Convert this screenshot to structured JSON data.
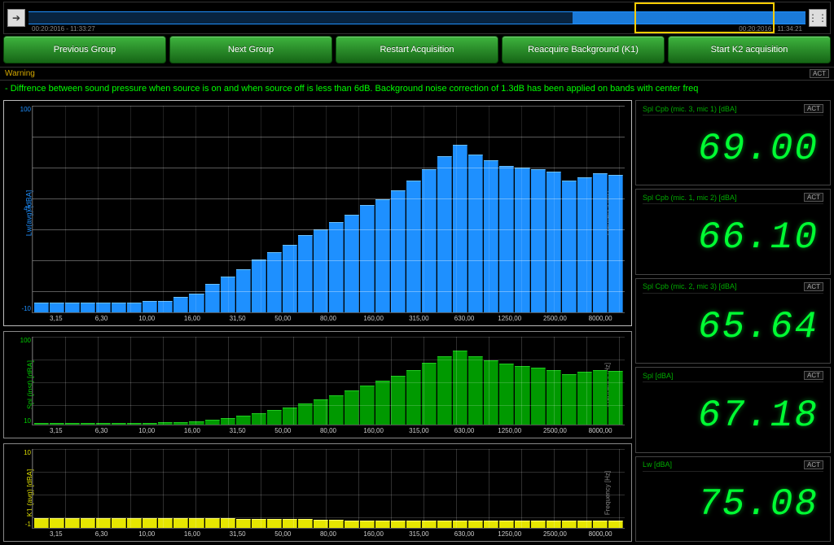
{
  "waveform": {
    "timestamp_left": "00:20:2016 - 11:33:27",
    "timestamp_right": "00:20:2016 - 11:34:21"
  },
  "buttons": {
    "prev": "Previous Group",
    "next": "Next Group",
    "restart": "Restart Acquisition",
    "reacquire": "Reacquire Background (K1)",
    "start": "Start K2 acquisition"
  },
  "warning": {
    "label": "Warning",
    "badge": "ACT",
    "text": "- Diffrence between sound pressure when source is on and when source off is less than 6dB. Background noise correction of 1.3dB has been applied on bands with center freq"
  },
  "axis": {
    "x_ticks": [
      "3,15",
      "6,30",
      "10,00",
      "16,00",
      "31,50",
      "50,00",
      "80,00",
      "160,00",
      "315,00",
      "630,00",
      "1250,00",
      "2500,00",
      "8000,00"
    ],
    "freq_label": "Frequency [Hz]"
  },
  "chart_data": [
    {
      "type": "bar",
      "name": "Lw(avg)",
      "ylabel": "Lw(avg) [dBA]",
      "y_ticks": [
        "100",
        "45",
        "-10"
      ],
      "ylim": [
        -10,
        100
      ],
      "color": "#1e90ff",
      "categories_ref": "axis.x_ticks",
      "values": [
        -5,
        -5,
        -5,
        -5,
        -5,
        -5,
        -5,
        -4,
        -4,
        -2,
        0,
        5,
        9,
        13,
        18,
        22,
        26,
        31,
        34,
        38,
        42,
        47,
        50,
        55,
        60,
        66,
        73,
        79,
        74,
        71,
        68,
        67,
        66,
        65,
        60,
        62,
        64,
        63
      ]
    },
    {
      "type": "bar",
      "name": "Spl(inst)",
      "ylabel": "Spl (inst) [dBA]",
      "y_ticks": [
        "100",
        "10"
      ],
      "ylim": [
        10,
        100
      ],
      "color": "#009900",
      "categories_ref": "axis.x_ticks",
      "values": [
        12,
        12,
        12,
        12,
        12,
        12,
        12,
        12,
        13,
        13,
        14,
        15,
        17,
        19,
        22,
        25,
        28,
        32,
        36,
        40,
        45,
        50,
        55,
        60,
        66,
        73,
        80,
        86,
        80,
        76,
        72,
        70,
        68,
        66,
        62,
        64,
        66,
        65
      ]
    },
    {
      "type": "bar",
      "name": "K1(avg)",
      "ylabel": "K1 (avg) [dBA]",
      "y_ticks": [
        "10",
        "-1"
      ],
      "ylim": [
        -1,
        10
      ],
      "color": "#e6e600",
      "categories_ref": "axis.x_ticks",
      "values": [
        0.4,
        0.4,
        0.4,
        0.4,
        0.4,
        0.4,
        0.4,
        0.4,
        0.4,
        0.4,
        0.4,
        0.4,
        0.35,
        0.3,
        0.3,
        0.25,
        0.25,
        0.2,
        0.15,
        0.1,
        0.05,
        0,
        0,
        0,
        0,
        0,
        0,
        0,
        0,
        0,
        0,
        0,
        0,
        0,
        0,
        0,
        0,
        0
      ]
    }
  ],
  "readouts": [
    {
      "label": "Spl Cpb (mic. 3, mic 1) [dBA]",
      "badge": "ACT",
      "value": "69.00"
    },
    {
      "label": "Spl Cpb (mic. 1, mic 2) [dBA]",
      "badge": "ACT",
      "value": "66.10"
    },
    {
      "label": "Spl Cpb (mic. 2, mic 3) [dBA]",
      "badge": "ACT",
      "value": "65.64"
    },
    {
      "label": "Spl [dBA]",
      "badge": "ACT",
      "value": "67.18"
    },
    {
      "label": "Lw [dBA]",
      "badge": "ACT",
      "value": "75.08"
    }
  ]
}
